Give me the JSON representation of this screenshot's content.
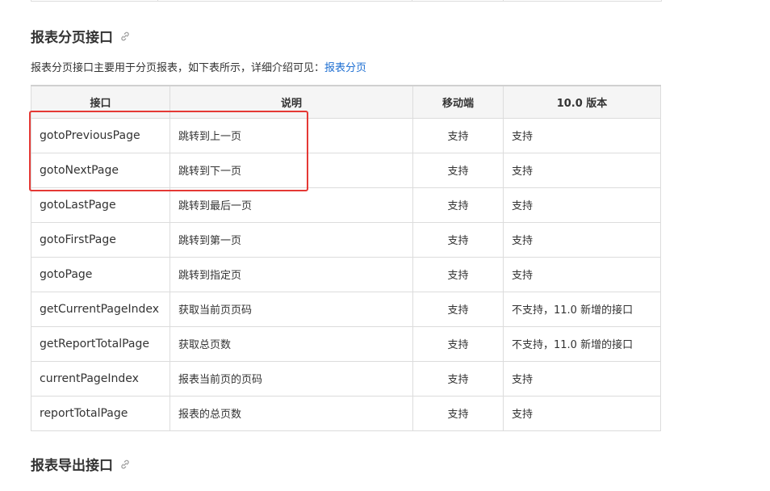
{
  "section1": {
    "title": "报表分页接口",
    "intro_text": "报表分页接口主要用于分页报表，如下表所示，详细介绍可见：",
    "intro_link": "报表分页"
  },
  "table": {
    "headers": [
      "接口",
      "说明",
      "移动端",
      "10.0 版本"
    ],
    "rows": [
      {
        "name": "gotoPreviousPage",
        "desc": "跳转到上一页",
        "mobile": "支持",
        "v10": "支持"
      },
      {
        "name": "gotoNextPage",
        "desc": "跳转到下一页",
        "mobile": "支持",
        "v10": "支持"
      },
      {
        "name": "gotoLastPage",
        "desc": "跳转到最后一页",
        "mobile": "支持",
        "v10": "支持"
      },
      {
        "name": "gotoFirstPage",
        "desc": "跳转到第一页",
        "mobile": "支持",
        "v10": "支持"
      },
      {
        "name": "gotoPage",
        "desc": "跳转到指定页",
        "mobile": "支持",
        "v10": "支持"
      },
      {
        "name": "getCurrentPageIndex",
        "desc": "获取当前页页码",
        "mobile": "支持",
        "v10": "不支持，11.0 新增的接口"
      },
      {
        "name": "getReportTotalPage",
        "desc": "获取总页数",
        "mobile": "支持",
        "v10": "不支持，11.0 新增的接口"
      },
      {
        "name": "currentPageIndex",
        "desc": "报表当前页的页码",
        "mobile": "支持",
        "v10": "支持"
      },
      {
        "name": "reportTotalPage",
        "desc": "报表的总页数",
        "mobile": "支持",
        "v10": "支持"
      }
    ]
  },
  "section2": {
    "title": "报表导出接口"
  },
  "icons": {
    "anchor": "link-icon"
  },
  "colors": {
    "link": "#1e6fd2",
    "highlight": "#e53935"
  }
}
